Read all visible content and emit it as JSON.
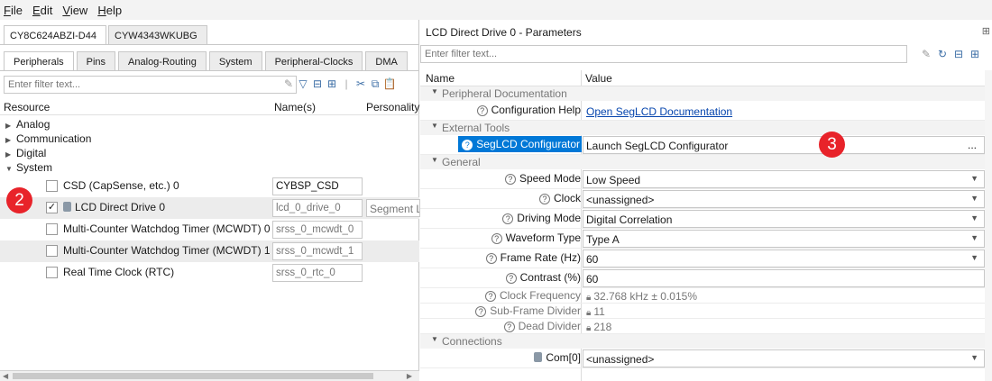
{
  "menu": [
    "File",
    "Edit",
    "View",
    "Help"
  ],
  "device_tabs": [
    "CY8C624ABZI-D44",
    "CYW4343WKUBG"
  ],
  "sub_tabs": [
    "Peripherals",
    "Pins",
    "Analog-Routing",
    "System",
    "Peripheral-Clocks",
    "DMA"
  ],
  "left": {
    "filter_placeholder": "Enter filter text...",
    "col_resource": "Resource",
    "col_names": "Name(s)",
    "col_personality": "Personality",
    "groups": [
      "Analog",
      "Communication",
      "Digital",
      "System"
    ],
    "resources": [
      {
        "label": "CSD (CapSense, etc.) 0",
        "name": "CYBSP_CSD",
        "checked": false
      },
      {
        "label": "LCD Direct Drive 0",
        "name": "lcd_0_drive_0",
        "personality": "Segment L",
        "checked": true
      },
      {
        "label": "Multi-Counter Watchdog Timer (MCWDT) 0",
        "name": "srss_0_mcwdt_0",
        "checked": false
      },
      {
        "label": "Multi-Counter Watchdog Timer (MCWDT) 1",
        "name": "srss_0_mcwdt_1",
        "checked": false
      },
      {
        "label": "Real Time Clock (RTC)",
        "name": "srss_0_rtc_0",
        "checked": false
      }
    ],
    "check_mark": "✓"
  },
  "right": {
    "title": "LCD Direct Drive 0 - Parameters",
    "filter_placeholder": "Enter filter text...",
    "col_name": "Name",
    "col_value": "Value",
    "cat_doc": "Peripheral Documentation",
    "config_help_label": "Configuration Help",
    "config_help_link": "Open SegLCD Documentation",
    "cat_ext": "External Tools",
    "seglcd_label": "SegLCD Configurator",
    "seglcd_value": "Launch SegLCD Configurator",
    "ellipsis": "...",
    "cat_general": "General",
    "general": [
      {
        "label": "Speed Mode",
        "value": "Low Speed"
      },
      {
        "label": "Clock",
        "value": "<unassigned>"
      },
      {
        "label": "Driving Mode",
        "value": "Digital Correlation"
      },
      {
        "label": "Waveform Type",
        "value": "Type A"
      },
      {
        "label": "Frame Rate (Hz)",
        "value": "60"
      },
      {
        "label": "Contrast (%)",
        "value": "60"
      }
    ],
    "readonly": [
      {
        "label": "Clock Frequency",
        "value": "32.768 kHz ± 0.015%"
      },
      {
        "label": "Sub-Frame Divider",
        "value": "11"
      },
      {
        "label": "Dead Divider",
        "value": "218"
      }
    ],
    "cat_conn": "Connections",
    "com_label": "Com[0]",
    "com_value": "<unassigned>"
  },
  "badges": {
    "left": "2",
    "right": "3"
  },
  "colors": {
    "accent": "#0078d7",
    "badge": "#e8232a",
    "link": "#0645ad"
  }
}
